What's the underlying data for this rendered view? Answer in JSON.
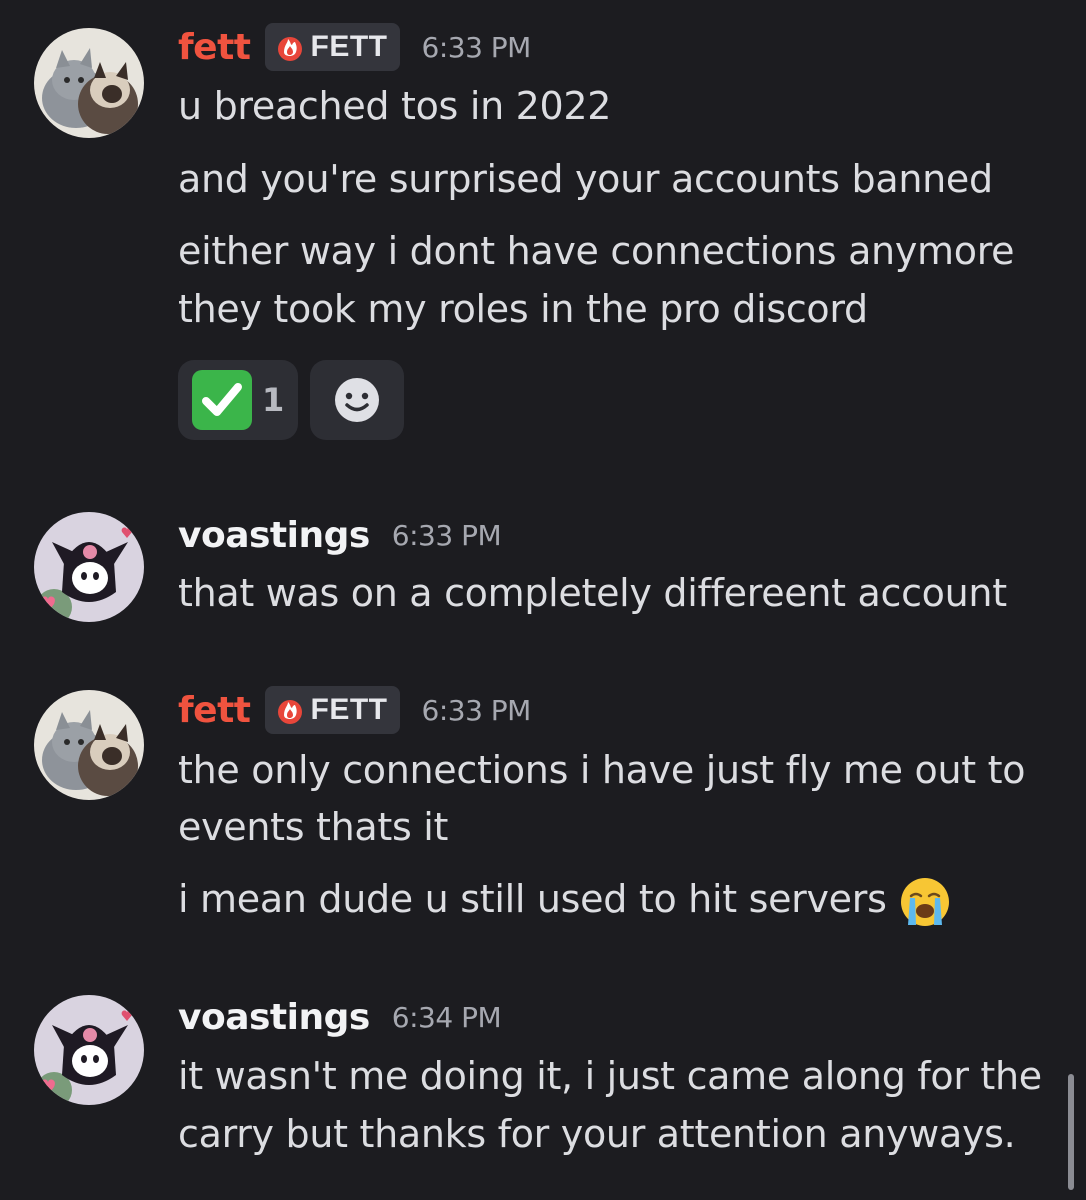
{
  "messages": [
    {
      "username": "fett",
      "tag": "FETT",
      "time": "6:33 PM",
      "lines": [
        "u breached tos in 2022",
        "and you're surprised your accounts banned",
        "either way i dont have connections anymore",
        "they took my roles in the pro discord"
      ],
      "reactions": [
        {
          "emoji": "check-mark-emoji",
          "count": "1"
        },
        {
          "emoji": "add-reaction-icon"
        }
      ]
    },
    {
      "username": "voastings",
      "time": "6:33 PM",
      "lines": [
        "that was on a completely differeent account"
      ]
    },
    {
      "username": "fett",
      "tag": "FETT",
      "time": "6:33 PM",
      "lines": [
        "the only connections i have just fly me out to",
        "events thats it",
        "i mean dude u still used to hit servers"
      ],
      "inline_emoji": "loudly-crying-face-emoji"
    },
    {
      "username": "voastings",
      "time": "6:34 PM",
      "lines": [
        "it wasn't me doing it, i just came along for the",
        "carry but thanks for your attention anyways."
      ]
    }
  ],
  "colors": {
    "background": "#1c1c20",
    "fett_name": "#f0533f",
    "voastings_name": "#f2f3f5",
    "text": "#dcdde1",
    "timestamp": "#a6a8b0"
  }
}
